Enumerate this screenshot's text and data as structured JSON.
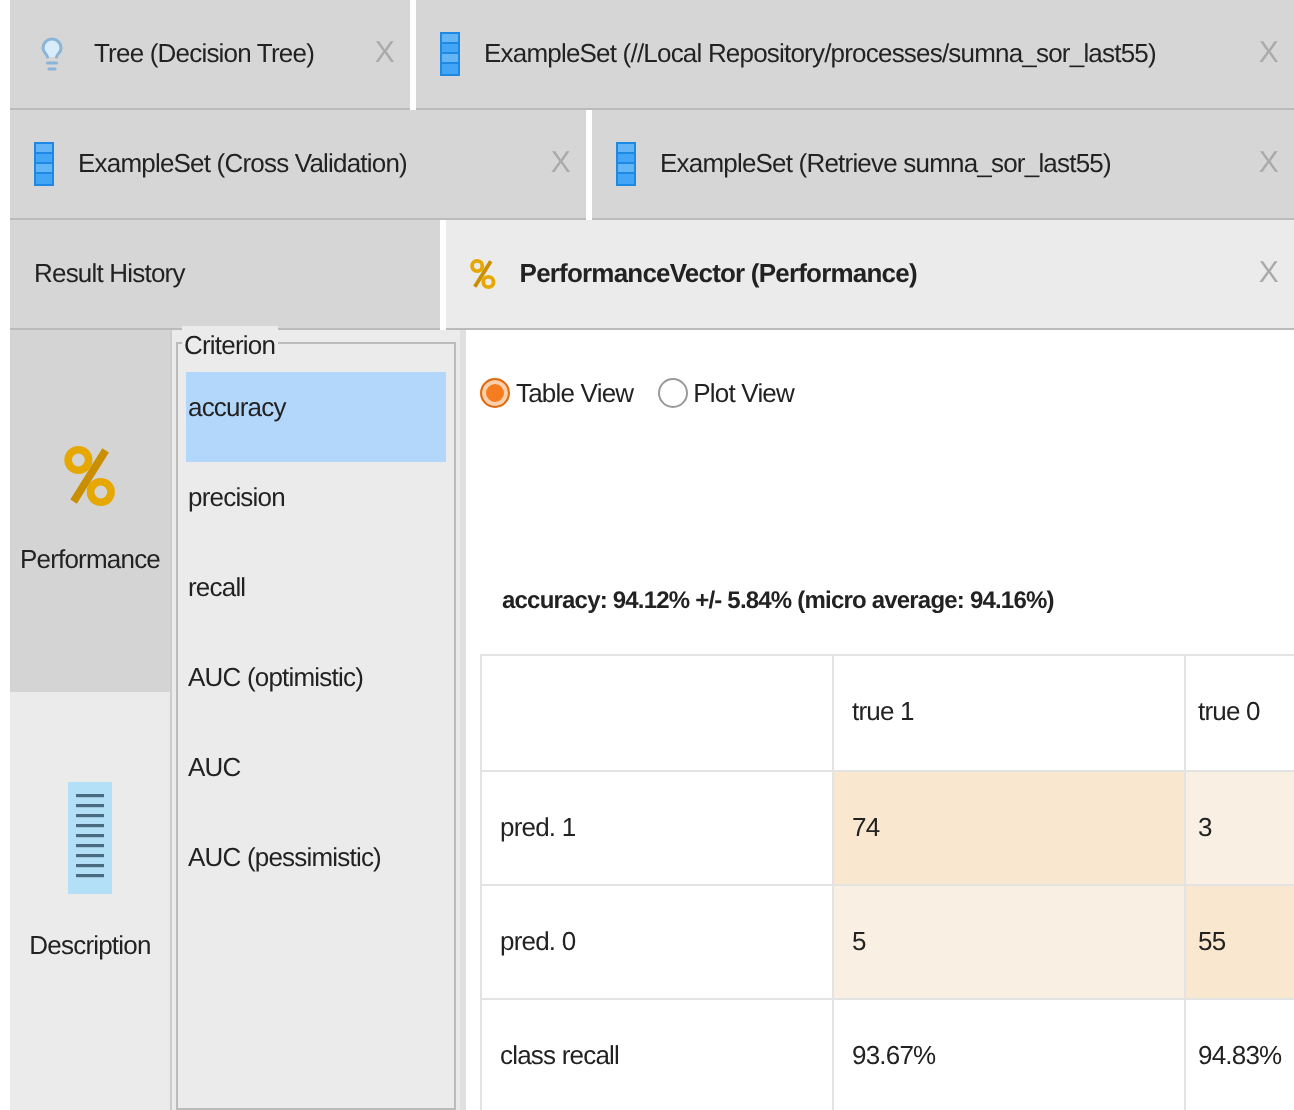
{
  "tab_rows": [
    [
      {
        "label": "Tree (Decision Tree)",
        "kind": "model",
        "close": "X",
        "selected": false
      },
      {
        "label": "ExampleSet (//Local Repository/processes/sumna_sor_last55)",
        "kind": "data",
        "close": "X",
        "selected": false
      }
    ],
    [
      {
        "label": "ExampleSet (Cross Validation)",
        "kind": "data",
        "close": "X",
        "selected": false
      },
      {
        "label": "ExampleSet (Retrieve sumna_sor_last55)",
        "kind": "data",
        "close": "X",
        "selected": false
      }
    ],
    [
      {
        "label": "Result History",
        "kind": "history",
        "selected": false
      },
      {
        "label": "PerformanceVector (Performance)",
        "kind": "performance",
        "close": "X",
        "selected": true
      }
    ]
  ],
  "side_views": [
    {
      "label": "Performance",
      "kind": "performance",
      "selected": true
    },
    {
      "label": "Description",
      "kind": "description",
      "selected": false
    }
  ],
  "criterion": {
    "title": "Criterion",
    "items": [
      {
        "label": "accuracy",
        "selected": true
      },
      {
        "label": "precision",
        "selected": false
      },
      {
        "label": "recall",
        "selected": false
      },
      {
        "label": "AUC (optimistic)",
        "selected": false
      },
      {
        "label": "AUC",
        "selected": false
      },
      {
        "label": "AUC (pessimistic)",
        "selected": false
      }
    ]
  },
  "view_options": [
    {
      "label": "Table View",
      "selected": true
    },
    {
      "label": "Plot View",
      "selected": false
    }
  ],
  "summary": "accuracy: 94.12% +/- 5.84% (micro average: 94.16%)",
  "table": {
    "columns": [
      "true 1",
      "true 0"
    ],
    "rows": [
      {
        "label": "pred. 1",
        "cells": [
          {
            "text": "74",
            "color": "#f9e7d0"
          },
          {
            "text": "3",
            "color": "#f9efe2"
          }
        ]
      },
      {
        "label": "pred. 0",
        "cells": [
          {
            "text": "5",
            "color": "#f9efe2"
          },
          {
            "text": "55",
            "color": "#f9e7d0"
          }
        ]
      },
      {
        "label": "class recall",
        "cells": [
          {
            "text": "93.67%"
          },
          {
            "text": "94.83%"
          }
        ]
      }
    ]
  }
}
